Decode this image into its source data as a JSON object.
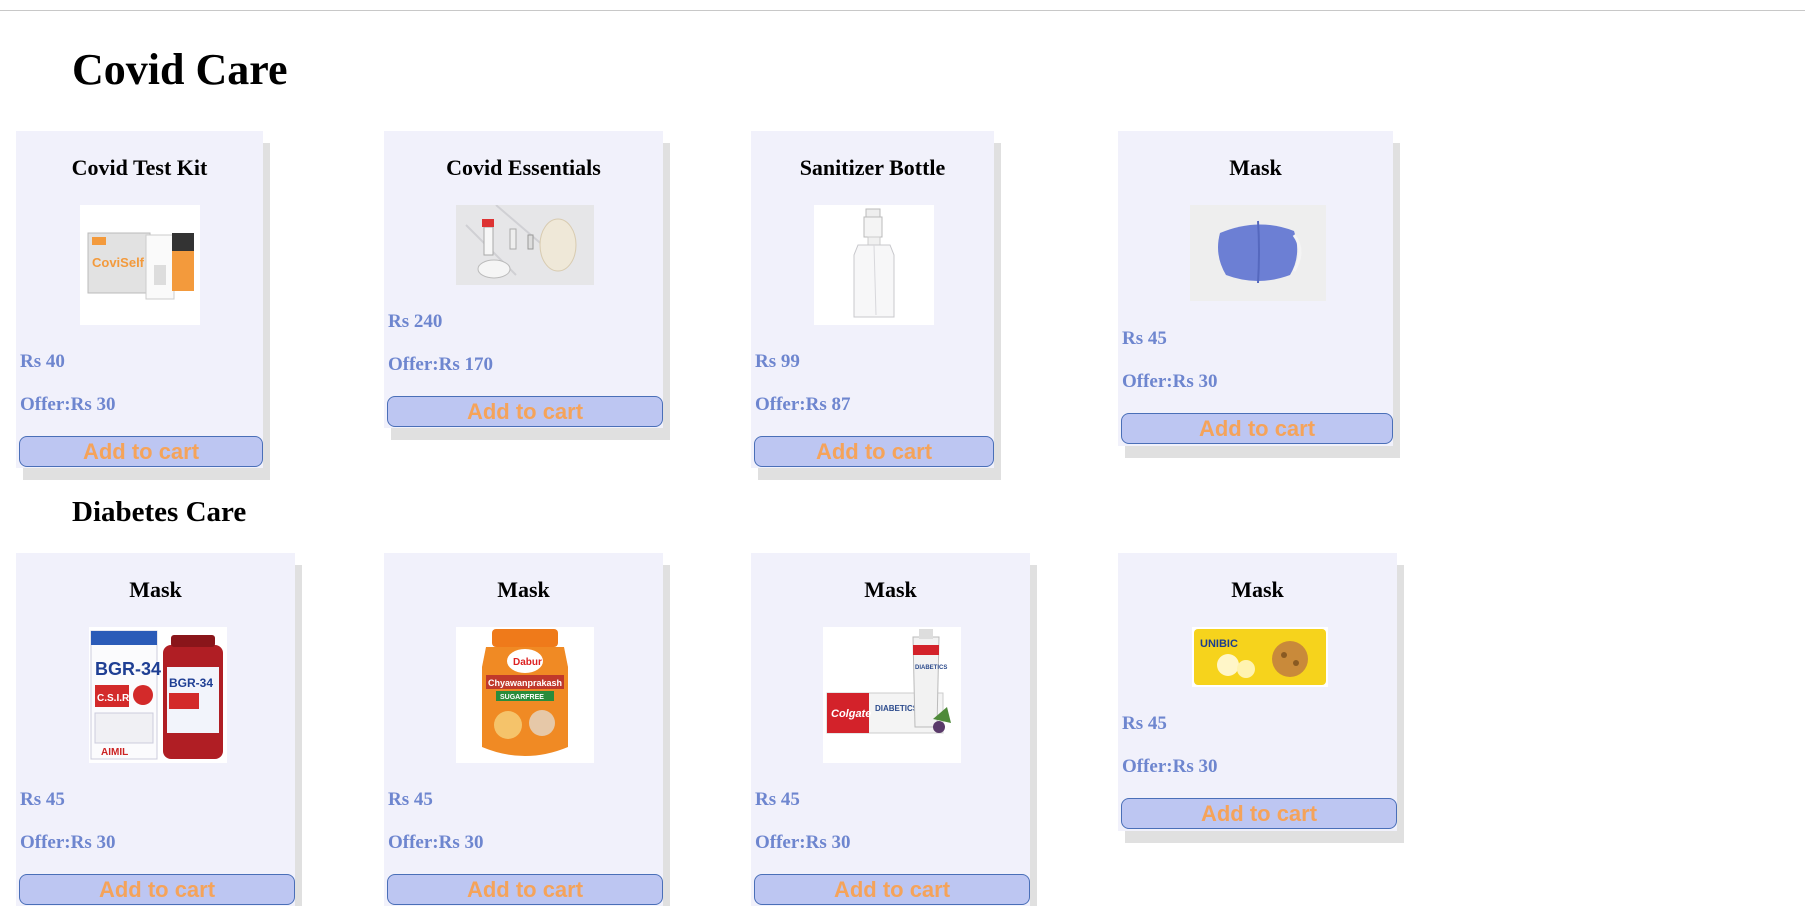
{
  "sections": {
    "covid": {
      "title": "Covid Care",
      "products": [
        {
          "name": "Covid Test Kit",
          "price": "Rs 40",
          "offer": "Offer:Rs 30",
          "cart": "Add to cart",
          "image": "covid-test-kit-image"
        },
        {
          "name": "Covid Essentials",
          "price": "Rs 240",
          "offer": "Offer:Rs 170",
          "cart": "Add to cart",
          "image": "covid-essentials-image"
        },
        {
          "name": "Sanitizer Bottle",
          "price": "Rs 99",
          "offer": "Offer:Rs 87",
          "cart": "Add to cart",
          "image": "sanitizer-bottle-image"
        },
        {
          "name": "Mask",
          "price": "Rs 45",
          "offer": "Offer:Rs 30",
          "cart": "Add to cart",
          "image": "mask-image"
        }
      ]
    },
    "diabetes": {
      "title": "Diabetes Care",
      "products": [
        {
          "name": "Mask",
          "price": "Rs 45",
          "offer": "Offer:Rs 30",
          "cart": "Add to cart",
          "image": "bgr-34-image",
          "image_text": [
            "BGR-34",
            "C.S.I.R",
            "AIMIL"
          ]
        },
        {
          "name": "Mask",
          "price": "Rs 45",
          "offer": "Offer:Rs 30",
          "cart": "Add to cart",
          "image": "chyawanprakash-jar-image",
          "image_text": [
            "Dabur",
            "Chyawanprakash",
            "SUGARFREE"
          ]
        },
        {
          "name": "Mask",
          "price": "Rs 45",
          "offer": "Offer:Rs 30",
          "cart": "Add to cart",
          "image": "colgate-diabetes-toothpaste-image",
          "image_text": [
            "Colgate",
            "DIABETICS"
          ]
        },
        {
          "name": "Mask",
          "price": "Rs 45",
          "offer": "Offer:Rs 30",
          "cart": "Add to cart",
          "image": "unibic-cookies-image",
          "image_text": [
            "UNIBIC"
          ]
        }
      ]
    }
  },
  "colors": {
    "card_bg": "#f1f1fb",
    "price_text": "#6e86cf",
    "button_bg": "#bdc6f2",
    "button_text": "#f5a35a",
    "button_border": "#4a6fb8"
  }
}
